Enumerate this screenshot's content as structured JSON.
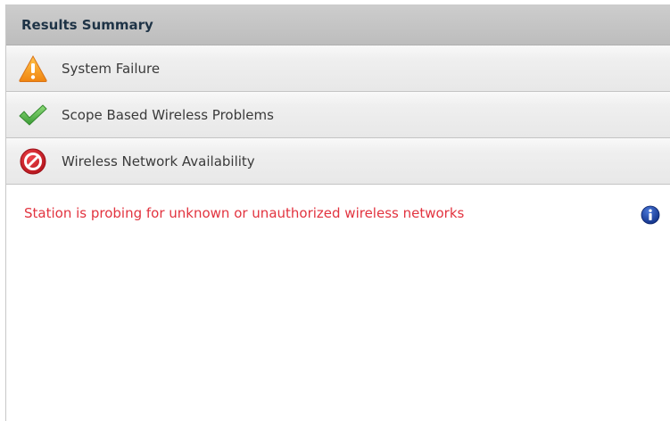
{
  "panel": {
    "title": "Results Summary"
  },
  "results": [
    {
      "label": "System Failure",
      "icon": "warning-icon",
      "status": "warning"
    },
    {
      "label": "Scope Based Wireless Problems",
      "icon": "check-icon",
      "status": "pass"
    },
    {
      "label": "Wireless Network Availability",
      "icon": "prohibited-icon",
      "status": "fail"
    }
  ],
  "message": {
    "text": "Station is probing for unknown or unauthorized wireless networks",
    "icon": "info-icon"
  },
  "colors": {
    "header_bg": "#c6c6c6",
    "title": "#1e3346",
    "message": "#e2333f",
    "warning": "#f7941d",
    "pass": "#4cae4c",
    "fail": "#d0202a",
    "info": "#1d3f9e"
  }
}
